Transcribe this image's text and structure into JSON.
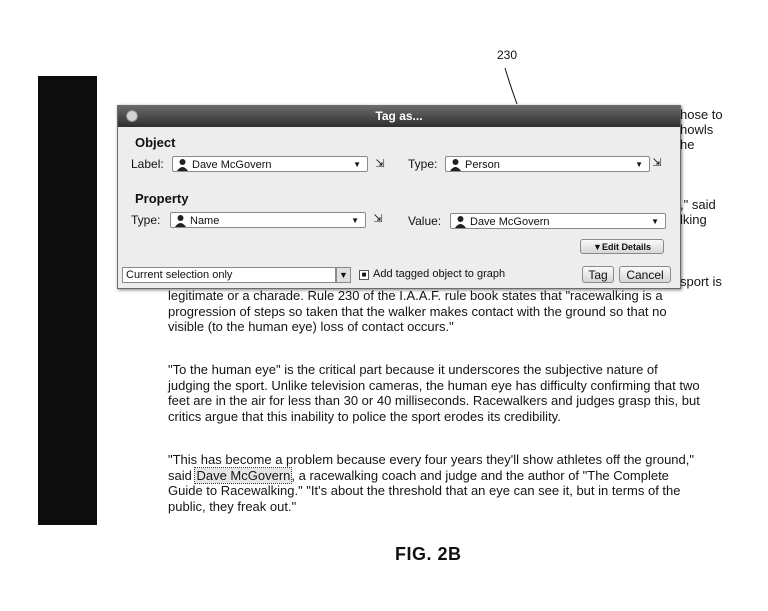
{
  "figure": {
    "reference_number": "230",
    "caption": "FIG. 2B"
  },
  "document": {
    "right_fragments": [
      "hose to",
      "howls",
      "he",
      ",\" said",
      "lking",
      "sport is"
    ],
    "para1_lines": [
      "legitimate or a charade. Rule 230 of the I.A.A.F. rule book states that \"racewalking is a",
      "progression of steps so taken that the walker makes contact with the ground so that no",
      "visible (to the human eye) loss of contact occurs.\""
    ],
    "para2_lines": [
      "\"To the human eye\" is the critical part because it underscores the subjective nature of",
      "judging the sport. Unlike television cameras, the human eye has difficulty confirming that two",
      "feet are in the air for less than 30 or 40 milliseconds. Racewalkers and judges grasp this, but",
      "critics argue that this inability to police the sport erodes its credibility."
    ],
    "para3_line1": "\"This has become a problem because every four years they'll show athletes off the ground,\"",
    "para3_line2_prefix": "said ",
    "para3_highlight": "Dave McGovern",
    "para3_line2_suffix": ", a racewalking coach and judge and the author of \"The Complete",
    "para3_rest": [
      "Guide to Racewalking.\" \"It's about the threshold that an eye can see it, but in terms of the",
      "public, they freak out.\""
    ]
  },
  "dialog": {
    "title": "Tag as...",
    "object_section": "Object",
    "object_label_caption": "Label:",
    "object_label_value": "Dave McGovern",
    "object_type_caption": "Type:",
    "object_type_value": "Person",
    "property_section": "Property",
    "property_type_caption": "Type:",
    "property_type_value": "Name",
    "property_value_caption": "Value:",
    "property_value_value": "Dave McGovern",
    "edit_details_label": "▼Edit Details",
    "scope_value": "Current selection only",
    "add_to_graph_label": "Add tagged object to graph",
    "add_to_graph_checked": true,
    "tag_button": "Tag",
    "cancel_button": "Cancel"
  },
  "icons": {
    "person": "person-icon",
    "combo_arrow": "chevron-down-icon",
    "side": "edit-icon"
  }
}
